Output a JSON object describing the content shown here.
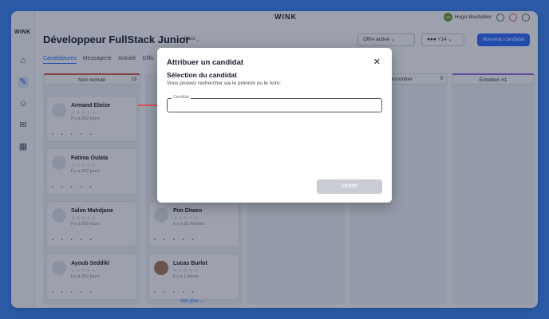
{
  "app": {
    "brand": "WINK",
    "logo": "WINK"
  },
  "user": {
    "initials": "HB",
    "name": "Hugo Bouhallier"
  },
  "page": {
    "title": "Développeur FullStack Junior",
    "location": "Paris",
    "status": "Offre active",
    "team_count": "+14",
    "new_candidate": "Nouveau candidat"
  },
  "tabs": [
    "Candidatures",
    "Messagerie",
    "Activité",
    "Diffu"
  ],
  "columns": [
    {
      "title": "Non recruté",
      "count": "13"
    },
    {
      "title": "À rencontrer",
      "count": "0"
    },
    {
      "title": "Entretien #1",
      "count": ""
    }
  ],
  "cards": [
    {
      "name": "Armand Eloise",
      "ago": "Il y a 252 jours"
    },
    {
      "name": "Fatima Oulata",
      "ago": "Il y a 252 jours"
    },
    {
      "name": "Salim Mahdjane",
      "ago": "Il y a 252 jours"
    },
    {
      "name": "Ayoub Seddiki",
      "ago": "Il y a 252 jours"
    },
    {
      "name": "Pim Dhaen",
      "ago": "Il y a 55 minutes"
    },
    {
      "name": "Lucas Burlot",
      "ago": "Il y a 1 heure"
    }
  ],
  "see_more": "Voir plus",
  "modal": {
    "title": "Attribuer un candidat",
    "subtitle": "Sélection du candidat",
    "hint": "Vous pouvez rechercher via le prénom ou le nom:",
    "field_label": "Candidat",
    "field_value": "",
    "submit": "Valider"
  },
  "colors": {
    "accent": "#2d6bff",
    "background": "#3d87f5",
    "arrow": "#e8383d"
  }
}
